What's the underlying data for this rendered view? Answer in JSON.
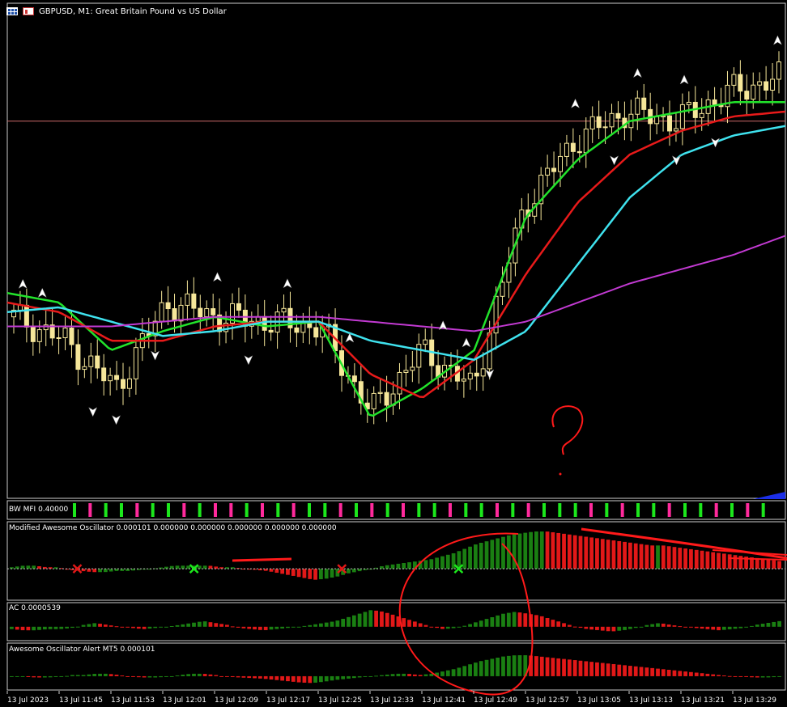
{
  "window": {
    "title": "GBPUSD, M1:  Great Britain Pound vs US Dollar",
    "icons": [
      "grid-icon",
      "chart-icon"
    ]
  },
  "colors": {
    "background": "#000000",
    "candle": "#f6e79a",
    "ma_green": "#22e32b",
    "ma_red": "#e81a1a",
    "ma_cyan": "#3fe2ee",
    "ma_magenta": "#c23ad2",
    "level_line": "#cc6a6a",
    "bull_bar": "#1a7f12",
    "bear_bar": "#e21818",
    "mfi_green": "#1ce71c",
    "mfi_pink": "#ff2a9c",
    "annotation": "#ff1a1a"
  },
  "chart_data": [
    {
      "type": "candlestick",
      "symbol": "GBPUSD",
      "timeframe": "M1",
      "title": "GBPUSD, M1:  Great Britain Pound vs US Dollar",
      "x": [
        "13 Jul 2023",
        "13 Jul 11:45",
        "13 Jul 11:53",
        "13 Jul 12:01",
        "13 Jul 12:09",
        "13 Jul 12:17",
        "13 Jul 12:25",
        "13 Jul 12:33",
        "13 Jul 12:41",
        "13 Jul 12:49",
        "13 Jul 12:57",
        "13 Jul 13:05",
        "13 Jul 13:13",
        "13 Jul 13:21",
        "13 Jul 13:29"
      ],
      "close_profile": [
        37,
        32,
        22,
        40,
        37,
        36,
        35,
        17,
        30,
        22,
        60,
        74,
        80,
        78,
        84,
        87
      ],
      "moving_averages": [
        {
          "role": "fast",
          "values": [
            42,
            40,
            30,
            34,
            37,
            35,
            36,
            16,
            22,
            30,
            58,
            70,
            78,
            80,
            82,
            82
          ]
        },
        {
          "role": "medium",
          "values": [
            40,
            38,
            32,
            32,
            35,
            36,
            36,
            25,
            20,
            28,
            46,
            61,
            71,
            76,
            79,
            80
          ]
        },
        {
          "role": "slow",
          "values": [
            38,
            39,
            36,
            33,
            34,
            36,
            36,
            32,
            30,
            28,
            34,
            48,
            62,
            71,
            75,
            77
          ]
        },
        {
          "role": "long",
          "values": [
            35,
            35,
            35,
            36,
            37,
            37,
            37,
            36,
            35,
            34,
            36,
            40,
            44,
            47,
            50,
            54
          ]
        }
      ],
      "level_line": 78
    },
    {
      "type": "bar",
      "name": "BW MFI",
      "label": "BW MFI 0.40000",
      "pattern": [
        "g",
        "p",
        "g",
        "g",
        "p",
        "g",
        "g",
        "p",
        "g",
        "p",
        "p",
        "g",
        "p",
        "g",
        "p",
        "g",
        "g",
        "p",
        "g",
        "p",
        "g",
        "p",
        "g",
        "g",
        "p",
        "g",
        "g",
        "p",
        "g",
        "p",
        "g",
        "g",
        "g",
        "p",
        "g",
        "p",
        "g",
        "g",
        "p",
        "g",
        "g",
        "p",
        "g",
        "p",
        "g"
      ]
    },
    {
      "type": "bar",
      "name": "Modified Awesome Oscillator",
      "label": "Modified Awesome Oscillator 0.000101 0.000000 0.000000 0.000000 0.000000 0.000000",
      "values": [
        1,
        2,
        2,
        1,
        1,
        -1,
        -2,
        -3,
        -3,
        -2,
        -2,
        -1,
        0,
        1,
        2,
        2,
        2,
        2,
        1,
        1,
        0,
        -1,
        -2,
        -4,
        -6,
        -8,
        -10,
        -9,
        -7,
        -4,
        -2,
        0,
        2,
        3,
        4,
        5,
        6,
        8,
        10,
        13,
        16,
        18,
        20,
        22,
        23,
        24,
        24,
        23,
        22,
        21,
        20,
        19,
        18,
        17,
        16,
        15,
        15,
        14,
        13,
        12,
        11,
        10,
        9,
        8,
        7,
        6,
        5
      ],
      "markers": [
        {
          "kind": "cross",
          "color": "red",
          "at": 0.09
        },
        {
          "kind": "cross",
          "color": "green",
          "at": 0.24
        },
        {
          "kind": "cross",
          "color": "red",
          "at": 0.43
        },
        {
          "kind": "cross",
          "color": "green",
          "at": 0.58
        }
      ]
    },
    {
      "type": "bar",
      "name": "AC",
      "label": "AC 0.0000539",
      "values": [
        -2,
        -3,
        -3,
        -2,
        -2,
        -1,
        1,
        2,
        1,
        0,
        -1,
        -2,
        -1,
        0,
        1,
        2,
        3,
        2,
        1,
        -1,
        -2,
        -3,
        -2,
        -1,
        0,
        1,
        2,
        3,
        5,
        7,
        9,
        8,
        6,
        4,
        2,
        0,
        -2,
        -1,
        1,
        3,
        5,
        7,
        8,
        7,
        6,
        4,
        2,
        0,
        -2,
        -3,
        -4,
        -3,
        -1,
        1,
        2,
        1,
        0,
        -1,
        -2,
        -3,
        -2,
        -1,
        1,
        2,
        3
      ]
    },
    {
      "type": "bar",
      "name": "Awesome Oscillator Alert MT5",
      "label": "Awesome Oscillator Alert MT5 0.000101",
      "values": [
        -1,
        -1,
        -2,
        -2,
        -1,
        1,
        1,
        2,
        2,
        1,
        -1,
        -2,
        -2,
        -1,
        1,
        2,
        2,
        1,
        -1,
        -2,
        -3,
        -4,
        -6,
        -8,
        -10,
        -11,
        -9,
        -6,
        -4,
        -2,
        0,
        1,
        2,
        2,
        1,
        2,
        4,
        6,
        9,
        12,
        14,
        16,
        17,
        17,
        16,
        15,
        14,
        13,
        12,
        11,
        10,
        9,
        8,
        7,
        6,
        5,
        4,
        3,
        2,
        1,
        0,
        -1,
        -2,
        -2,
        -1
      ]
    }
  ]
}
